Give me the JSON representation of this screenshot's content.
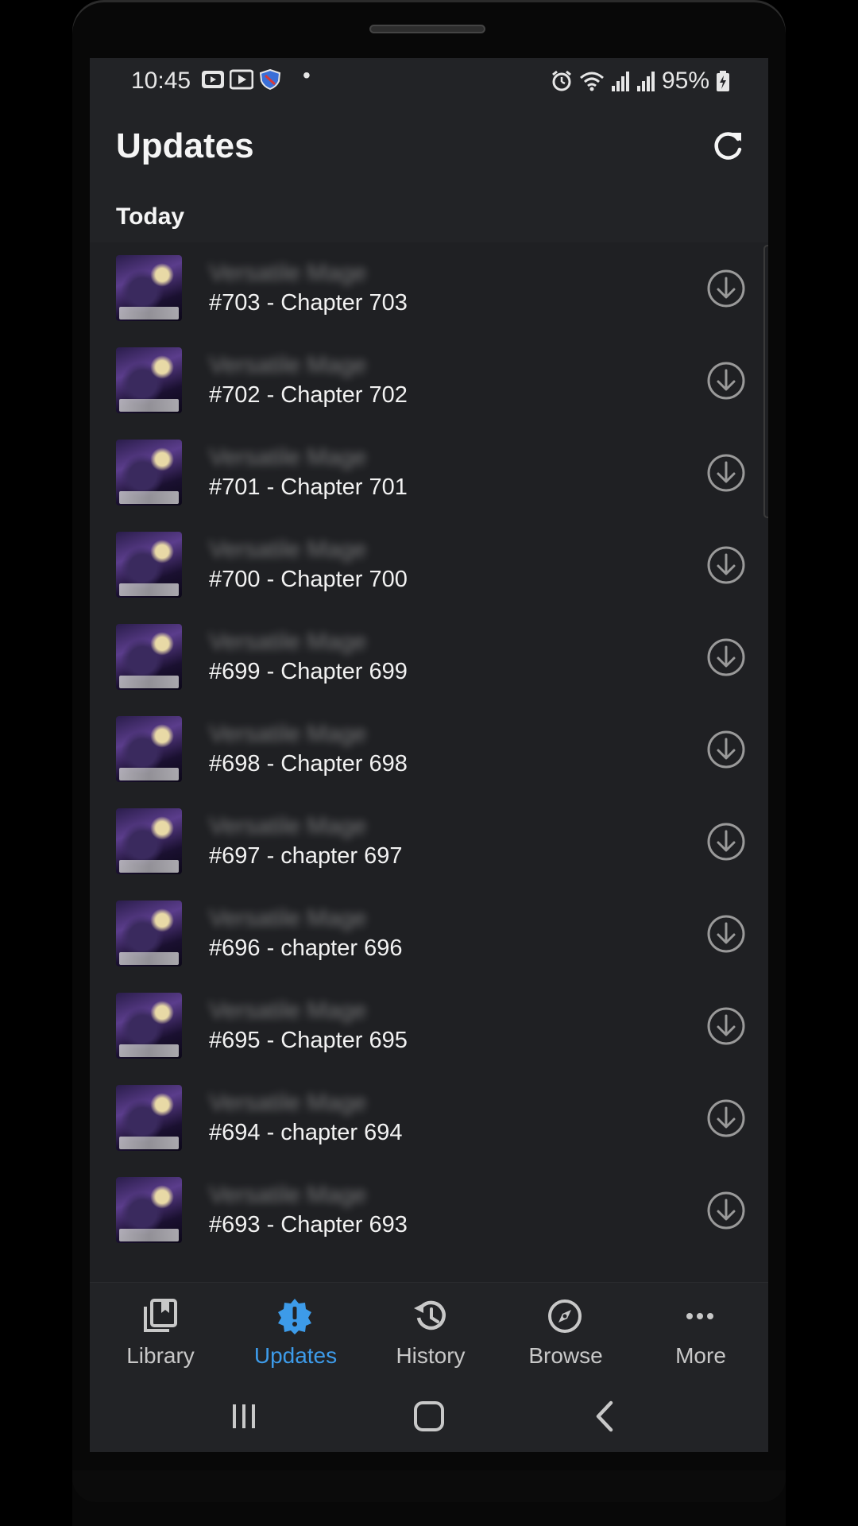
{
  "status_bar": {
    "time": "10:45",
    "battery": "95%",
    "left_icons": [
      "youtube-notification-icon",
      "play-store-notification-icon",
      "shield-notification-icon"
    ],
    "right_icons": [
      "alarm-icon",
      "wifi-icon",
      "signal-icon",
      "signal-icon",
      "battery-charging-icon"
    ]
  },
  "header": {
    "title": "Updates",
    "refresh_icon": "refresh-icon"
  },
  "section": {
    "label": "Today"
  },
  "updates": [
    {
      "series": "Versatile Mage",
      "chapter": "#703 - Chapter 703"
    },
    {
      "series": "Versatile Mage",
      "chapter": "#702 - Chapter 702"
    },
    {
      "series": "Versatile Mage",
      "chapter": "#701 - Chapter 701"
    },
    {
      "series": "Versatile Mage",
      "chapter": "#700 - Chapter 700"
    },
    {
      "series": "Versatile Mage",
      "chapter": "#699 - Chapter 699"
    },
    {
      "series": "Versatile Mage",
      "chapter": "#698 - Chapter 698"
    },
    {
      "series": "Versatile Mage",
      "chapter": "#697 - chapter 697"
    },
    {
      "series": "Versatile Mage",
      "chapter": "#696 - chapter 696"
    },
    {
      "series": "Versatile Mage",
      "chapter": "#695 - Chapter 695"
    },
    {
      "series": "Versatile Mage",
      "chapter": "#694 - chapter 694"
    },
    {
      "series": "Versatile Mage",
      "chapter": "#693 - Chapter 693"
    }
  ],
  "bottom_nav": {
    "items": [
      {
        "label": "Library",
        "icon": "library-icon"
      },
      {
        "label": "Updates",
        "icon": "updates-badge-icon",
        "active": true
      },
      {
        "label": "History",
        "icon": "history-icon"
      },
      {
        "label": "Browse",
        "icon": "compass-icon"
      },
      {
        "label": "More",
        "icon": "more-horizontal-icon"
      }
    ]
  },
  "colors": {
    "background": "#222326",
    "list_background": "#1f2023",
    "accent": "#3d9be9",
    "text_primary": "#f2f2f2",
    "text_secondary": "#c8c8c8"
  }
}
